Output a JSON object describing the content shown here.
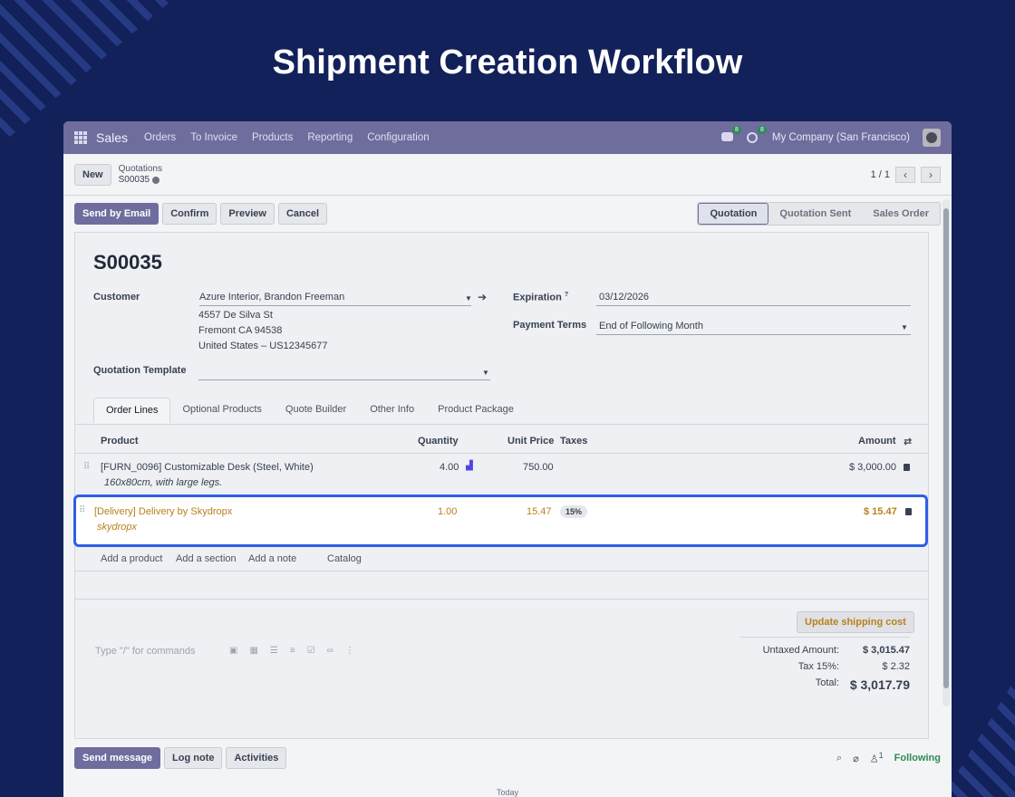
{
  "page_title": "Shipment Creation Workflow",
  "navbar": {
    "app_name": "Sales",
    "menu": [
      "Orders",
      "To Invoice",
      "Products",
      "Reporting",
      "Configuration"
    ],
    "messages_badge": "8",
    "activities_badge": "8",
    "company": "My Company (San Francisco)"
  },
  "control_panel": {
    "new_label": "New",
    "breadcrumb_parent": "Quotations",
    "breadcrumb_current": "S00035",
    "pager": "1 / 1"
  },
  "status": {
    "buttons": [
      "Send by Email",
      "Confirm",
      "Preview",
      "Cancel"
    ],
    "stages": [
      "Quotation",
      "Quotation Sent",
      "Sales Order"
    ],
    "active_stage": "Quotation"
  },
  "form": {
    "name": "S00035",
    "customer_label": "Customer",
    "customer_value": "Azure Interior, Brandon Freeman",
    "address_lines": [
      "4557 De Silva St",
      "Fremont CA 94538",
      "United States – US12345677"
    ],
    "expiration_label": "Expiration",
    "expiration_help": "?",
    "expiration_value": "03/12/2026",
    "payment_terms_label": "Payment Terms",
    "payment_terms_value": "End of Following Month",
    "template_label": "Quotation Template",
    "template_value": ""
  },
  "tabs": [
    "Order Lines",
    "Optional Products",
    "Quote Builder",
    "Other Info",
    "Product Package"
  ],
  "lines_header": {
    "product": "Product",
    "quantity": "Quantity",
    "unit_price": "Unit Price",
    "taxes": "Taxes",
    "amount": "Amount"
  },
  "lines": [
    {
      "product": "[FURN_0096] Customizable Desk (Steel, White)",
      "description": "160x80cm, with large legs.",
      "quantity": "4.00",
      "unit_price": "750.00",
      "tax": "",
      "amount": "$ 3,000.00"
    },
    {
      "product": "[Delivery] Delivery by Skydropx",
      "description": "skydropx",
      "quantity": "1.00",
      "unit_price": "15.47",
      "tax": "15%",
      "amount": "$ 15.47"
    }
  ],
  "add_links": [
    "Add a product",
    "Add a section",
    "Add a note",
    "Catalog"
  ],
  "update_shipping_label": "Update shipping cost",
  "note_placeholder": "Type \"/\" for commands",
  "totals": {
    "untaxed_label": "Untaxed Amount:",
    "untaxed_value": "$ 3,015.47",
    "tax_label": "Tax 15%:",
    "tax_value": "$ 2.32",
    "total_label": "Total:",
    "total_value": "$ 3,017.79"
  },
  "chatter": {
    "buttons": [
      "Send message",
      "Log note",
      "Activities"
    ],
    "followers_count": "1",
    "following_label": "Following",
    "today_label": "Today"
  },
  "colors": {
    "background": "#13215a",
    "navbar": "#6f6d9e",
    "highlight_border": "#2f5ee8",
    "delivery_text": "#b7811b",
    "following": "#2e8b57"
  }
}
